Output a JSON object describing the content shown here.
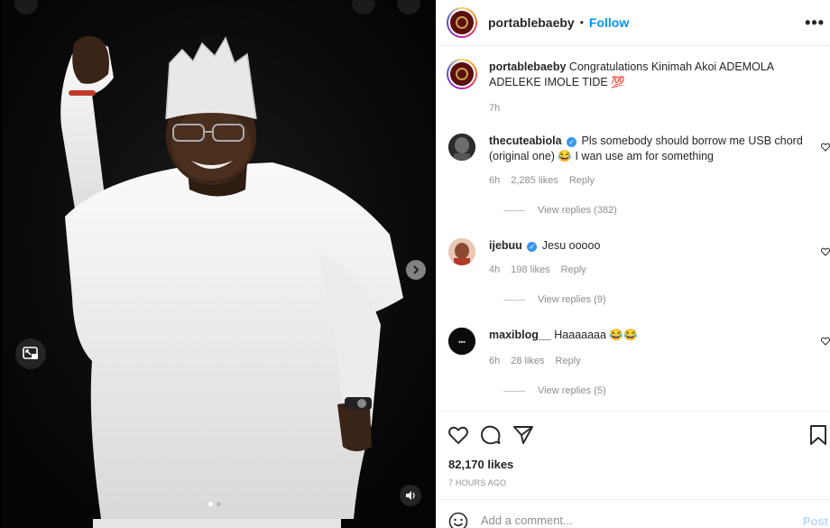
{
  "media": {
    "controls": {
      "next_icon": "chevron-right-icon",
      "expand_icon": "picture-in-picture-icon",
      "volume_icon": "speaker-icon"
    },
    "carousel_dots": {
      "count": 2,
      "active": 0
    }
  },
  "header": {
    "username": "portablebaeby",
    "separator": "•",
    "follow_label": "Follow",
    "more_label": "•••"
  },
  "caption": {
    "username": "portablebaeby",
    "text": "Congratulations Kinimah Akoi ADEMOLA ADELEKE IMOLE TIDE 💯",
    "time": "7h"
  },
  "comments": [
    {
      "username": "thecuteabiola",
      "verified": true,
      "text": "Pls somebody should borrow me USB chord (original one) 😂 I wan use am for something",
      "time": "6h",
      "likes": "2,285 likes",
      "reply_label": "Reply",
      "view_replies": "View replies (382)"
    },
    {
      "username": "ijebuu",
      "verified": true,
      "text": "Jesu ooooo",
      "time": "4h",
      "likes": "198 likes",
      "reply_label": "Reply",
      "view_replies": "View replies (9)"
    },
    {
      "username": "maxiblog__",
      "verified": false,
      "text": "Haaaaaaa 😂😂",
      "time": "6h",
      "likes": "28 likes",
      "reply_label": "Reply",
      "view_replies": "View replies (5)"
    }
  ],
  "actions": {
    "like_icon": "heart-icon",
    "comment_icon": "comment-bubble-icon",
    "share_icon": "paper-plane-icon",
    "save_icon": "bookmark-icon",
    "likes_count": "82,170 likes",
    "time_ago": "7 HOURS AGO"
  },
  "add_comment": {
    "emoji_icon": "smiley-icon",
    "placeholder": "Add a comment...",
    "post_label": "Post"
  },
  "colors": {
    "accent": "#0095f6",
    "verified": "#3897f0",
    "muted": "#8e8e8e"
  }
}
